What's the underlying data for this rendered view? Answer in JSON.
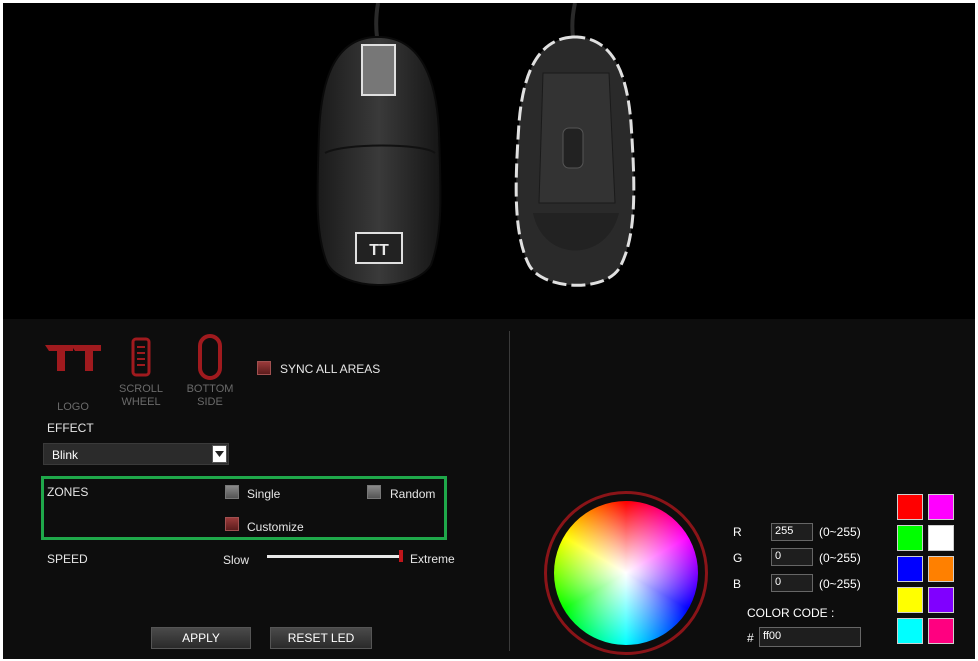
{
  "zones": [
    {
      "label": "LOGO"
    },
    {
      "label": "SCROLL\nWHEEL"
    },
    {
      "label": "BOTTOM\nSIDE"
    }
  ],
  "sync_label": "SYNC ALL AREAS",
  "effect": {
    "label": "EFFECT",
    "selected": "Blink"
  },
  "zone_mode": {
    "label": "ZONES",
    "single": "Single",
    "random": "Random",
    "customize": "Customize"
  },
  "speed": {
    "label": "SPEED",
    "min": "Slow",
    "max": "Extreme",
    "value": 1.0
  },
  "buttons": {
    "apply": "APPLY",
    "reset": "RESET LED"
  },
  "rgb": {
    "r_label": "R",
    "g_label": "G",
    "b_label": "B",
    "r": "255",
    "g": "0",
    "b": "0",
    "range": "(0~255)"
  },
  "color_code": {
    "label": "COLOR CODE :",
    "hash": "#",
    "value": "ff00"
  },
  "swatches": [
    "#ff0000",
    "#ff00ff",
    "#00ff00",
    "#ffffff",
    "#0000ff",
    "#ff8000",
    "#ffff00",
    "#8000ff",
    "#00ffff",
    "#ff0080"
  ],
  "colors": {
    "accent_red": "#8a1418",
    "zone_highlight": "#1fa84a"
  }
}
